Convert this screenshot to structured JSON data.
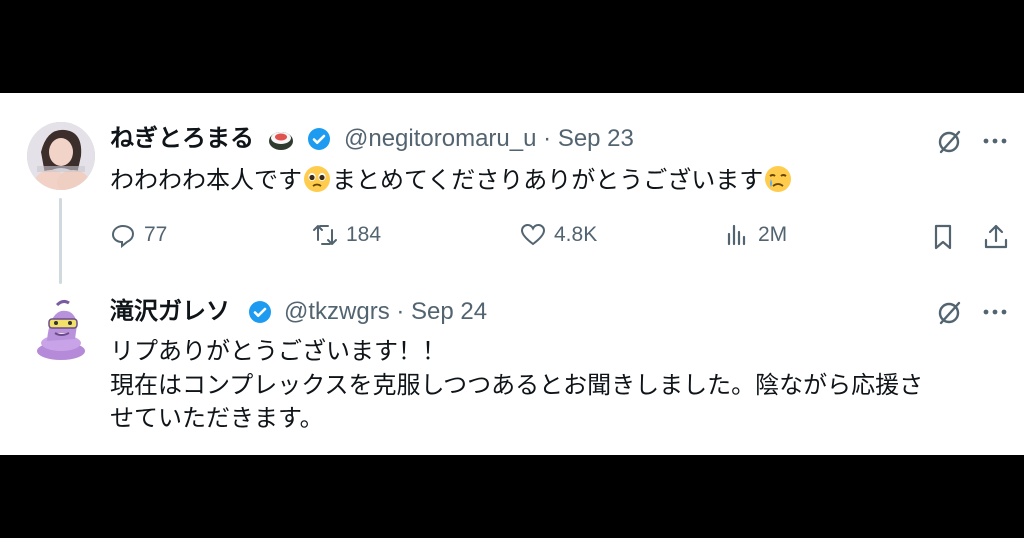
{
  "tweet1": {
    "name": "ねぎとろまる",
    "handle": "@negitoromaru_u",
    "date": "Sep 23",
    "text_part1": "わわわわ本人です",
    "text_part2": "まとめてくださりありがとうございます",
    "replies": "77",
    "retweets": "184",
    "likes": "4.8K",
    "views": "2M"
  },
  "tweet2": {
    "name": "滝沢ガレソ",
    "handle": "@tkzwgrs",
    "date": "Sep 24",
    "line1": "リプありがとうございます！！",
    "line2": "現在はコンプレックスを克服しつつあるとお聞きしました。陰ながら応援さ",
    "line3": "せていただきます。"
  },
  "sep": "·",
  "colors": {
    "verified": "#1d9bf0",
    "muted": "#536471",
    "text": "#0f1419"
  }
}
